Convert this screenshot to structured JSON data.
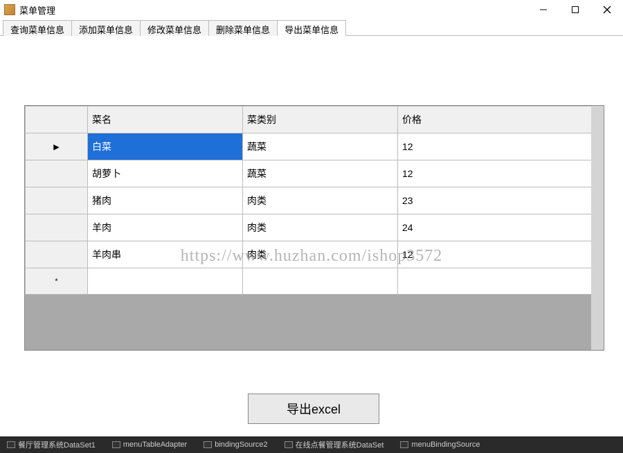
{
  "window": {
    "title": "菜单管理"
  },
  "tabs": [
    {
      "label": "查询菜单信息",
      "active": false
    },
    {
      "label": "添加菜单信息",
      "active": false
    },
    {
      "label": "修改菜单信息",
      "active": false
    },
    {
      "label": "删除菜单信息",
      "active": false
    },
    {
      "label": "导出菜单信息",
      "active": true
    }
  ],
  "grid": {
    "columns": [
      "菜名",
      "菜类别",
      "价格"
    ],
    "rows": [
      {
        "name": "白菜",
        "type": "蔬菜",
        "price": "12",
        "current": true,
        "selectedCol": 0
      },
      {
        "name": "胡萝卜",
        "type": "蔬菜",
        "price": "12"
      },
      {
        "name": "猪肉",
        "type": "肉类",
        "price": "23"
      },
      {
        "name": "羊肉",
        "type": "肉类",
        "price": "24"
      },
      {
        "name": "羊肉串",
        "type": "肉类",
        "price": "12"
      }
    ],
    "newRowMarker": "*",
    "currentRowMarker": "▶"
  },
  "buttons": {
    "export": "导出excel"
  },
  "watermark": "https://www.huzhan.com/ishop3572",
  "statusbar": [
    "餐厅管理系统DataSet1",
    "menuTableAdapter",
    "bindingSource2",
    "在线点餐管理系统DataSet",
    "menuBindingSource"
  ]
}
